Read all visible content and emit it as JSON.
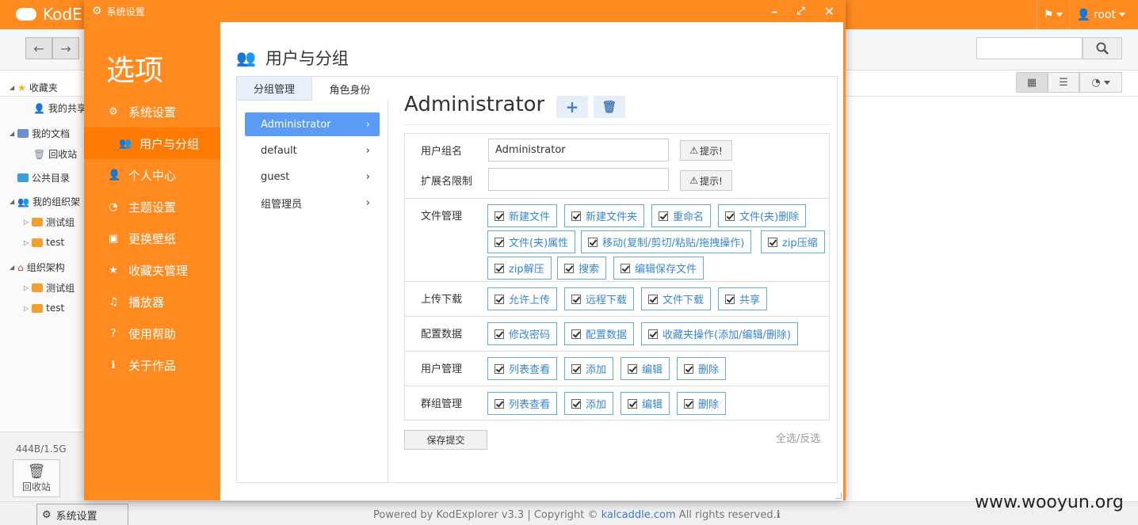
{
  "app": {
    "name": "KodE",
    "user": "root"
  },
  "sidebar_tree": {
    "items": [
      {
        "label": "收藏夹"
      },
      {
        "label": "我的共享"
      },
      {
        "label": "我的文档"
      },
      {
        "label": "回收站"
      },
      {
        "label": "公共目录"
      },
      {
        "label": "我的组织架"
      },
      {
        "label": "测试组"
      },
      {
        "label": "test"
      },
      {
        "label": "组织架构"
      },
      {
        "label": "测试组"
      },
      {
        "label": "test"
      }
    ],
    "usage": "444B/1.5G",
    "trash_label": "回收站"
  },
  "footer": {
    "powered": "Powered by KodExplorer v3.3 | Copyright ©",
    "link": "kalcaddle.com",
    "rights": "All rights reserved.",
    "task_label": "系统设置"
  },
  "watermark": "www.wooyun.org",
  "dialog": {
    "title": "系统设置",
    "heading": "选项",
    "menu": [
      {
        "label": "系统设置",
        "icon": "gear-icon",
        "glyph": "⚙"
      },
      {
        "label": "用户与分组",
        "icon": "users-icon",
        "glyph": "👥"
      },
      {
        "label": "个人中心",
        "icon": "user-icon",
        "glyph": "👤"
      },
      {
        "label": "主题设置",
        "icon": "dashboard-icon",
        "glyph": "◔"
      },
      {
        "label": "更换壁纸",
        "icon": "image-icon",
        "glyph": "▣"
      },
      {
        "label": "收藏夹管理",
        "icon": "star-icon",
        "glyph": "★"
      },
      {
        "label": "播放器",
        "icon": "music-icon",
        "glyph": "♫"
      },
      {
        "label": "使用帮助",
        "icon": "question-icon",
        "glyph": "?"
      },
      {
        "label": "关于作品",
        "icon": "info-icon",
        "glyph": "ℹ"
      }
    ],
    "page_title": "用户与分组",
    "tabs": [
      "分组管理",
      "角色身份"
    ],
    "roles": [
      "Administrator",
      "default",
      "guest",
      "组管理员"
    ],
    "role_title": "Administrator",
    "form": {
      "group_name_label": "用户组名",
      "group_name_value": "Administrator",
      "ext_label": "扩展名限制",
      "ext_value": "",
      "hint_label": "提示!",
      "sections": [
        {
          "label": "文件管理",
          "options": [
            "新建文件",
            "新建文件夹",
            "重命名",
            "文件(夹)删除",
            "文件(夹)属性",
            "移动(复制/剪切/粘贴/拖拽操作)",
            "zip压缩",
            "zip解压",
            "搜索",
            "编辑保存文件"
          ]
        },
        {
          "label": "上传下载",
          "options": [
            "允许上传",
            "远程下载",
            "文件下载",
            "共享"
          ]
        },
        {
          "label": "配置数据",
          "options": [
            "修改密码",
            "配置数据",
            "收藏夹操作(添加/编辑/删除)"
          ]
        },
        {
          "label": "用户管理",
          "options": [
            "列表查看",
            "添加",
            "编辑",
            "删除"
          ]
        },
        {
          "label": "群组管理",
          "options": [
            "列表查看",
            "添加",
            "编辑",
            "删除"
          ]
        }
      ]
    },
    "save_label": "保存提交",
    "select_all_label": "全选/反选"
  }
}
